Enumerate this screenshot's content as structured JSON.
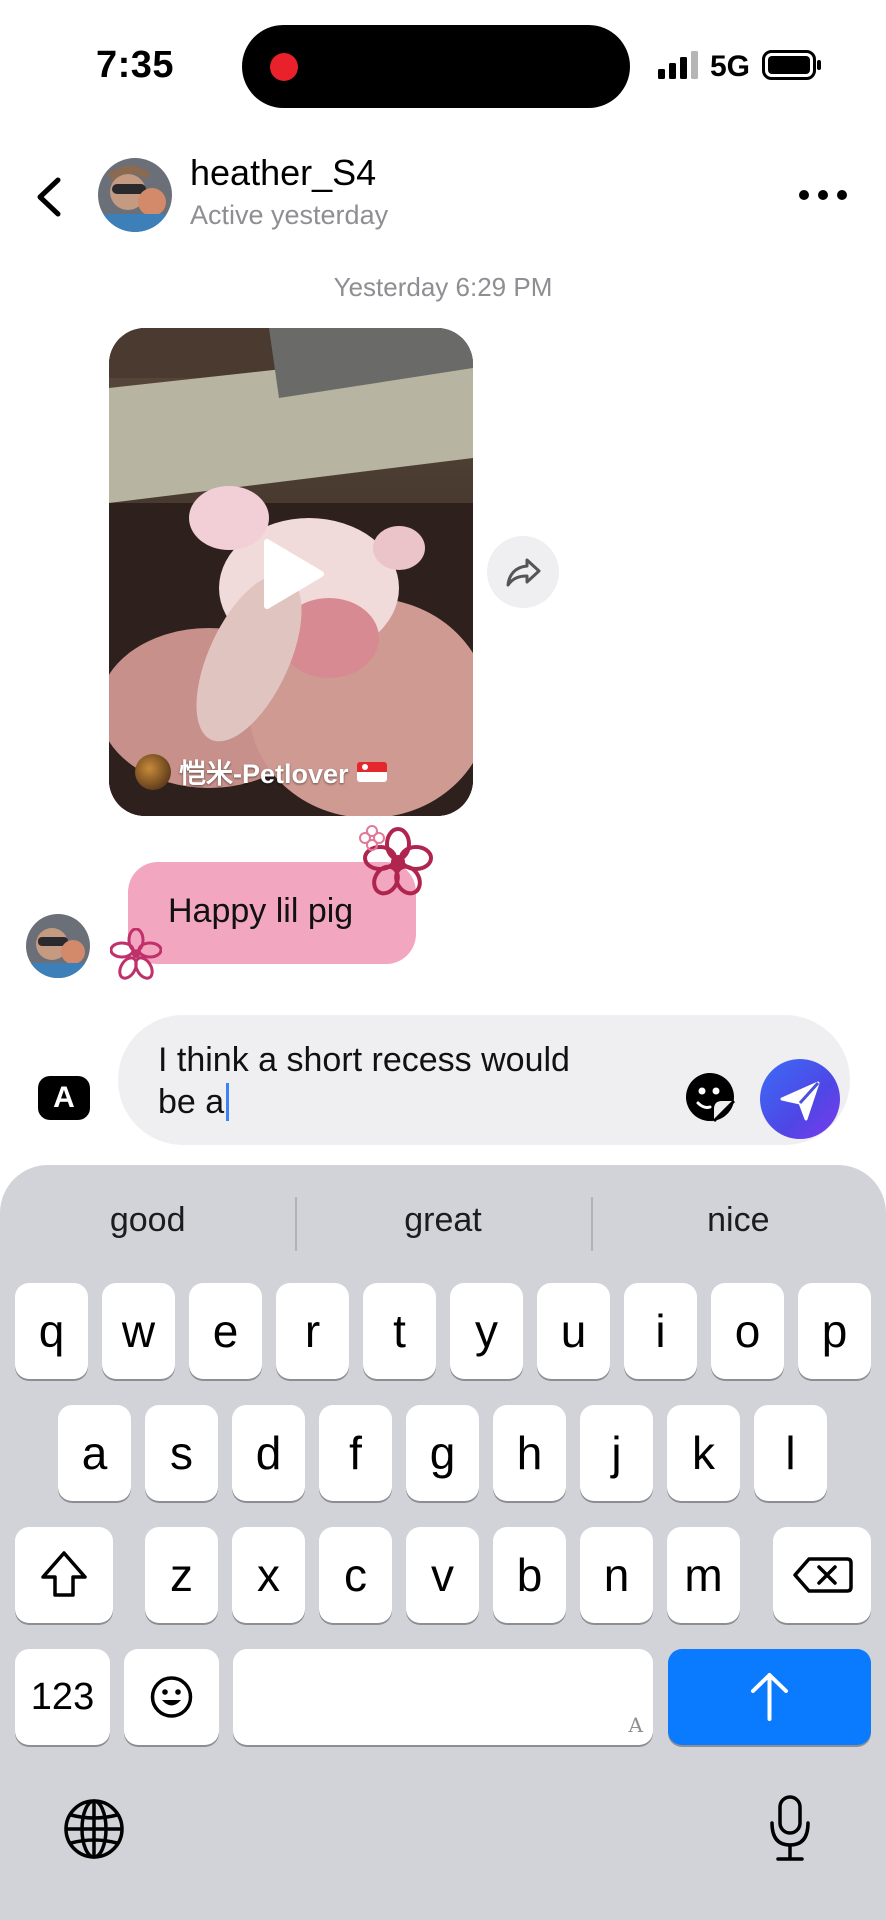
{
  "status_bar": {
    "time": "7:35",
    "network": "5G",
    "recording_dot_color": "#e8212a"
  },
  "header": {
    "username": "heather_S4",
    "active_status": "Active yesterday"
  },
  "thread": {
    "timestamp": "Yesterday 6:29 PM",
    "video": {
      "owner_name": "恺米-Petlover"
    },
    "message": {
      "text": "Happy lil pig",
      "bubble_color": "#f3a6c0"
    }
  },
  "composer": {
    "input_line1": "I think a short recess would",
    "input_line2": "be a",
    "text_style_label": "A"
  },
  "keyboard": {
    "suggestions": [
      "good",
      "great",
      "nice"
    ],
    "row1": [
      "q",
      "w",
      "e",
      "r",
      "t",
      "y",
      "u",
      "i",
      "o",
      "p"
    ],
    "row2": [
      "a",
      "s",
      "d",
      "f",
      "g",
      "h",
      "j",
      "k",
      "l"
    ],
    "row3": [
      "z",
      "x",
      "c",
      "v",
      "b",
      "n",
      "m"
    ],
    "numbers_label": "123",
    "space_hint": "A",
    "return_color": "#0a7aff"
  }
}
